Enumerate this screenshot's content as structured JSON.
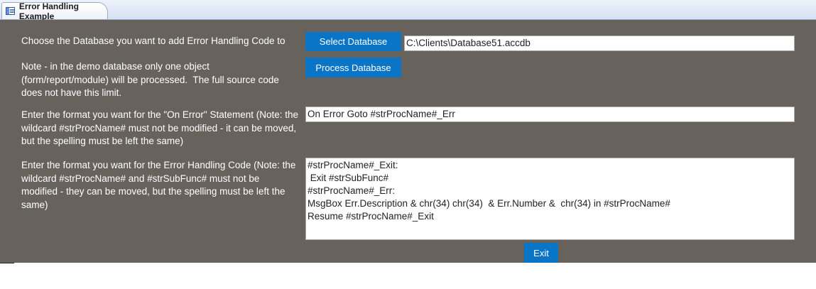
{
  "tab": {
    "title": "Error Handling Example",
    "icon": "form-icon"
  },
  "labels": {
    "choose_db": "Choose the Database you want to add Error Handling Code to",
    "note": "Note - in the demo database only one object (form/report/module) will be processed.  The full source code does not have this limit.",
    "on_error_format": "Enter the format you want for the \"On Error\" Statement (Note: the wildcard #strProcName# must not be modified - it can be moved, but the spelling must be left the same)",
    "handling_code_format": "Enter the format you want for the Error Handling Code (Note: the wildcard #strProcName# and #strSubFunc# must not be modified - they can be moved, but the spelling must be left the same)"
  },
  "buttons": {
    "select_database": "Select Database",
    "process_database": "Process Database",
    "exit": "Exit"
  },
  "fields": {
    "database_path": "C:\\Clients\\Database51.accdb",
    "on_error_statement": "On Error Goto #strProcName#_Err",
    "error_handling_code": "#strProcName#_Exit:\n Exit #strSubFunc#\n#strProcName#_Err:\nMsgBox Err.Description & chr(34) chr(34)  & Err.Number &  chr(34) in #strProcName#\nResume #strProcName#_Exit"
  },
  "colors": {
    "form_background": "#67625b",
    "button": "#0a74c6"
  }
}
